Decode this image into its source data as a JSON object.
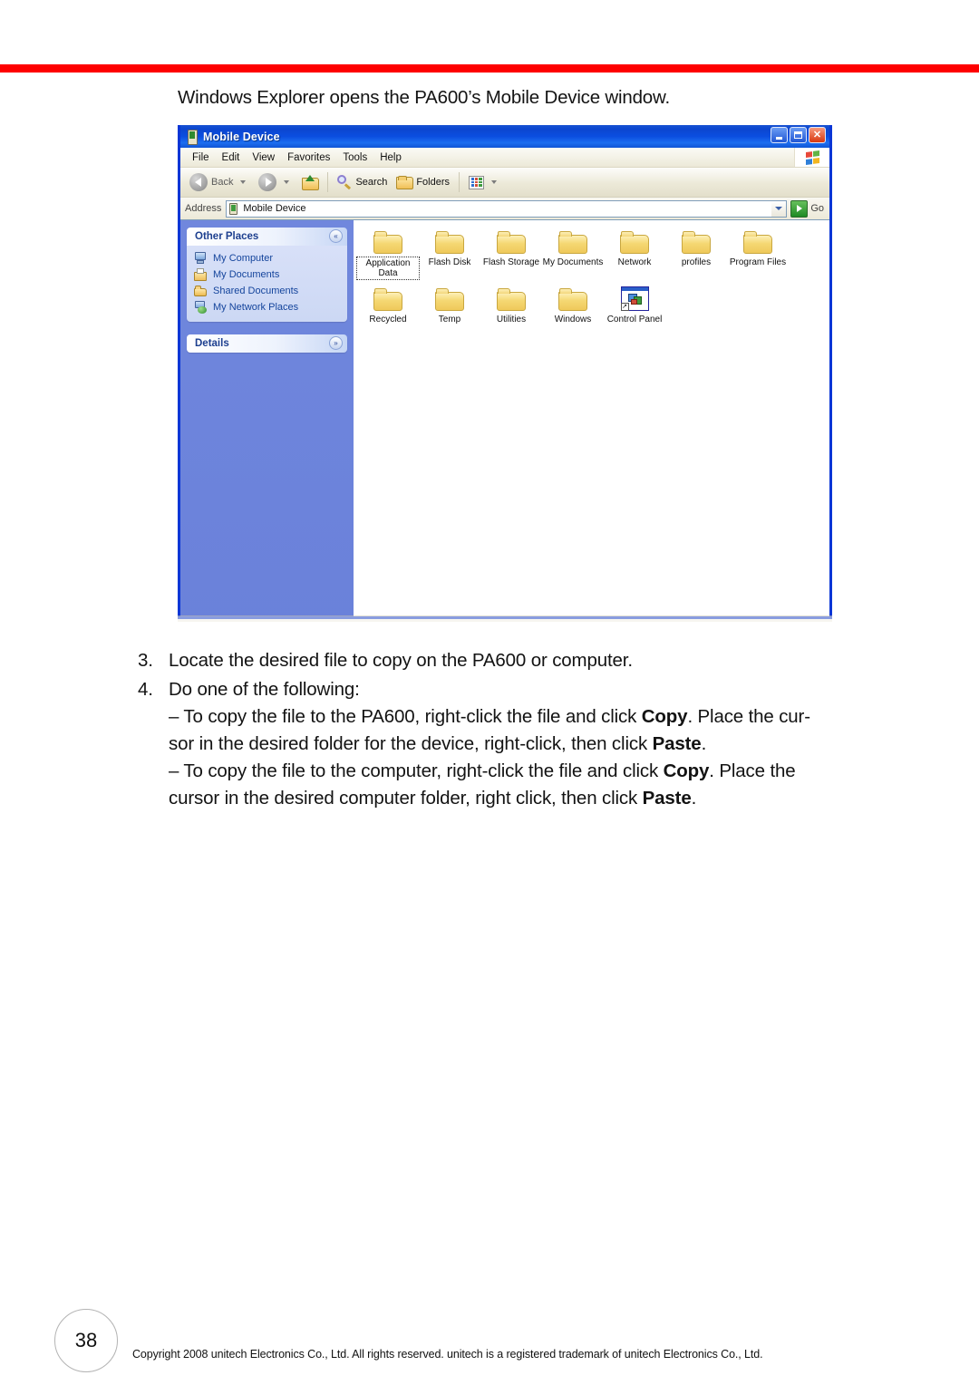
{
  "page": {
    "intro_text": "Windows Explorer opens the PA600’s Mobile Device window.",
    "page_number": "38",
    "copyright": "Copyright 2008 unitech Electronics Co., Ltd. All rights reserved. unitech is a registered trademark of unitech Electronics Co., Ltd.",
    "rule_color": "#fe0000"
  },
  "explorer": {
    "titlebar": {
      "title": "Mobile Device",
      "icon": "mobile-device-icon",
      "minimize": "_",
      "maximize": "□",
      "close": "✕"
    },
    "menus": [
      "File",
      "Edit",
      "View",
      "Favorites",
      "Tools",
      "Help"
    ],
    "toolbar": {
      "back_label": "Back",
      "forward_label": "",
      "up_label": "",
      "search_label": "Search",
      "folders_label": "Folders",
      "views_label": ""
    },
    "address": {
      "label": "Address",
      "value": "Mobile Device",
      "go_label": "Go"
    },
    "sidebar": {
      "panels": [
        {
          "title": "Other Places",
          "collapse_glyph": "«",
          "items": [
            {
              "label": "My Computer",
              "icon": "my-computer-icon"
            },
            {
              "label": "My Documents",
              "icon": "my-documents-icon"
            },
            {
              "label": "Shared Documents",
              "icon": "shared-documents-icon"
            },
            {
              "label": "My Network Places",
              "icon": "my-network-places-icon"
            }
          ]
        },
        {
          "title": "Details",
          "collapse_glyph": "»",
          "items": []
        }
      ]
    },
    "files": [
      {
        "name": "Application Data",
        "type": "folder",
        "selected": true,
        "wrap": true
      },
      {
        "name": "Flash Disk",
        "type": "folder",
        "selected": false,
        "wrap": false
      },
      {
        "name": "Flash Storage",
        "type": "folder",
        "selected": false,
        "wrap": false
      },
      {
        "name": "My Documents",
        "type": "folder",
        "selected": false,
        "wrap": false
      },
      {
        "name": "Network",
        "type": "folder",
        "selected": false,
        "wrap": false
      },
      {
        "name": "profiles",
        "type": "folder",
        "selected": false,
        "wrap": false
      },
      {
        "name": "Program Files",
        "type": "folder",
        "selected": false,
        "wrap": false
      },
      {
        "name": "Recycled",
        "type": "folder",
        "selected": false,
        "wrap": false
      },
      {
        "name": "Temp",
        "type": "folder",
        "selected": false,
        "wrap": false
      },
      {
        "name": "Utilities",
        "type": "folder",
        "selected": false,
        "wrap": false
      },
      {
        "name": "Windows",
        "type": "folder",
        "selected": false,
        "wrap": false
      },
      {
        "name": "Control Panel",
        "type": "control-panel-shortcut",
        "selected": false,
        "wrap": false
      }
    ]
  },
  "steps": [
    {
      "number": "3.",
      "lines": [
        {
          "parts": [
            {
              "t": "Locate the desired file to copy on the PA600 or computer.",
              "b": false
            }
          ]
        }
      ]
    },
    {
      "number": "4.",
      "lines": [
        {
          "parts": [
            {
              "t": "Do one of the following:",
              "b": false
            }
          ]
        },
        {
          "parts": [
            {
              "t": "– To copy the file to the PA600, right-click the file and click ",
              "b": false
            },
            {
              "t": "Copy",
              "b": true
            },
            {
              "t": ". Place the cur-",
              "b": false
            }
          ]
        },
        {
          "parts": [
            {
              "t": "sor in the desired folder for the device, right-click, then click ",
              "b": false
            },
            {
              "t": "Paste",
              "b": true
            },
            {
              "t": ".",
              "b": false
            }
          ]
        },
        {
          "parts": [
            {
              "t": "– To copy the file to the computer, right-click the file and click ",
              "b": false
            },
            {
              "t": "Copy",
              "b": true
            },
            {
              "t": ". Place the",
              "b": false
            }
          ]
        },
        {
          "parts": [
            {
              "t": "cursor in the desired computer folder, right click, then click ",
              "b": false
            },
            {
              "t": "Paste",
              "b": true
            },
            {
              "t": ".",
              "b": false
            }
          ]
        }
      ]
    }
  ]
}
